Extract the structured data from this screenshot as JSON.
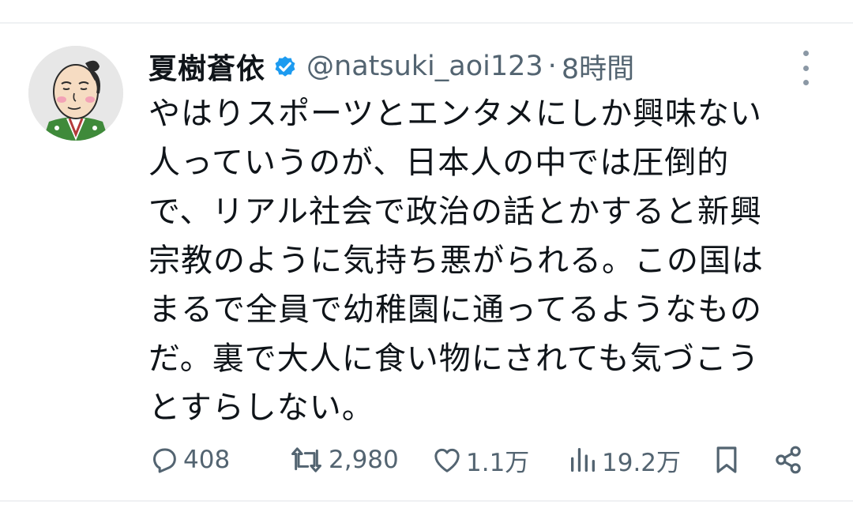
{
  "tweet": {
    "author_name": "夏樹蒼依",
    "handle": "@natsuki_aoi123",
    "separator": "·",
    "time": "8時間",
    "text_lines": [
      "やはりスポーツとエンタメにしか興味ない",
      "人っていうのが、日本人の中では圧倒的",
      "で、リアル社会で政治の話とかすると新興",
      "宗教のように気持ち悪がられる。この国は",
      "まるで全員で幼稚園に通ってるようなもの",
      "だ。裏で大人に食い物にされても気づこう",
      "とすらしない。"
    ]
  },
  "actions": {
    "replies": "408",
    "retweets": "2,980",
    "likes": "1.1万",
    "views": "19.2万"
  },
  "icons": {
    "verified": "verified-badge-icon",
    "more": "more-vertical-icon",
    "reply": "reply-icon",
    "retweet": "retweet-icon",
    "like": "heart-icon",
    "views": "views-icon",
    "bookmark": "bookmark-icon",
    "share": "share-icon"
  },
  "colors": {
    "text": "#0f1419",
    "secondary": "#536471",
    "verified": "#1d9bf0",
    "divider": "#eff1f3"
  }
}
